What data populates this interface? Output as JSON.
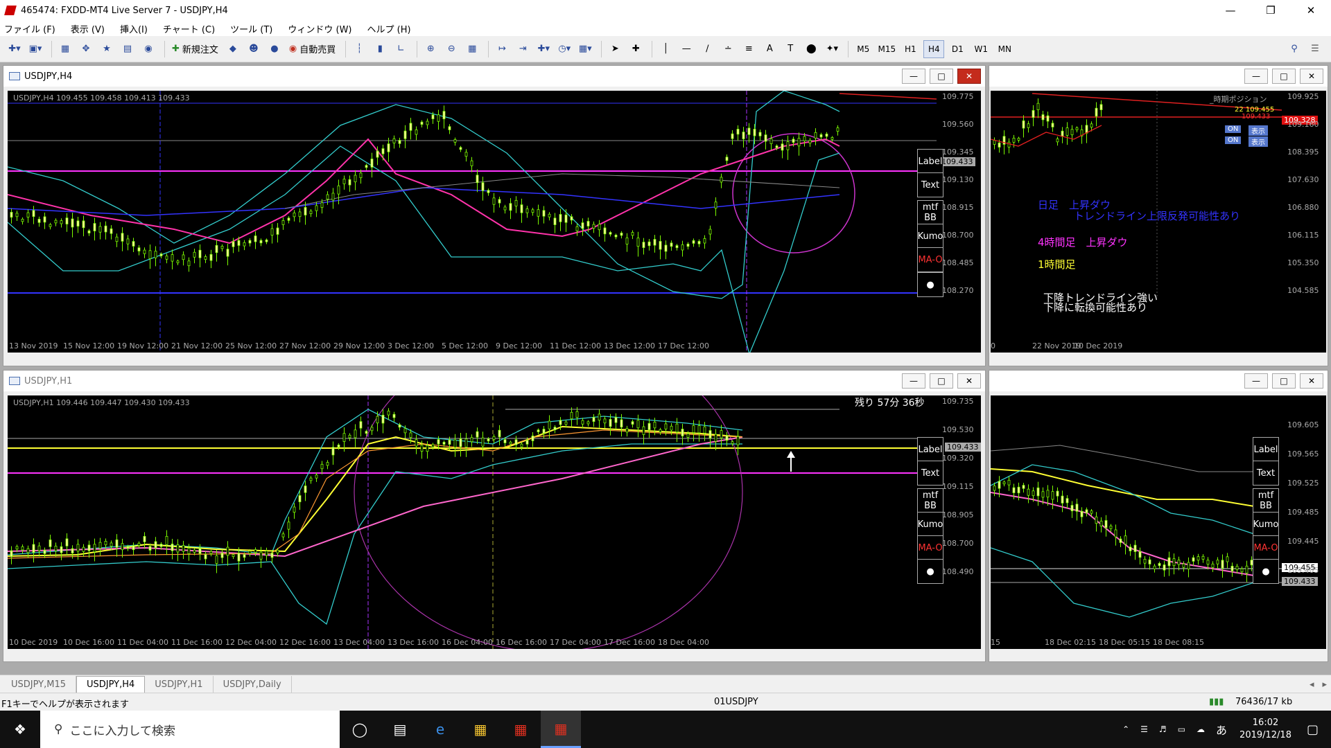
{
  "window": {
    "title": "465474: FXDD-MT4 Live Server 7 - USDJPY,H4"
  },
  "menu": [
    "ファイル (F)",
    "表示 (V)",
    "挿入(I)",
    "チャート (C)",
    "ツール (T)",
    "ウィンドウ (W)",
    "ヘルプ (H)"
  ],
  "toolbar": {
    "new_order": "新規注文",
    "auto_trade": "自動売買",
    "timeframes": [
      "M5",
      "M15",
      "H1",
      "H4",
      "D1",
      "W1",
      "MN"
    ],
    "active_timeframe": "H4"
  },
  "panel_buttons": [
    {
      "l1": "Label"
    },
    {
      "l1": "Text"
    },
    {
      "l1": "mtf",
      "l2": "BB"
    },
    {
      "l1": "Kumo"
    },
    {
      "l1": "MA-O"
    },
    {
      "l1": "●"
    }
  ],
  "charts": {
    "h4": {
      "window_title": "USDJPY,H4",
      "symbol_line": "USDJPY,H4  109.455 109.458 109.413 109.433",
      "current_price": "109.433",
      "price_labels": [
        "109.775",
        "109.560",
        "109.345",
        "109.130",
        "108.915",
        "108.700",
        "108.485",
        "108.270"
      ],
      "time_labels": [
        "13 Nov 2019",
        "15 Nov 12:00",
        "19 Nov 12:00",
        "21 Nov 12:00",
        "25 Nov 12:00",
        "27 Nov 12:00",
        "29 Nov 12:00",
        "3 Dec 12:00",
        "5 Dec 12:00",
        "9 Dec 12:00",
        "11 Dec 12:00",
        "13 Dec 12:00",
        "17 Dec 12:00"
      ]
    },
    "daily": {
      "position_label": "_時期ポジション",
      "line1": "22 109.455",
      "line2": "109.433",
      "red_price": "109.328",
      "on_labels": [
        "ON",
        "ON"
      ],
      "show_labels": [
        "表示",
        "表示"
      ],
      "price_labels": [
        "109.925",
        "109.160",
        "108.395",
        "107.630",
        "106.880",
        "106.115",
        "105.350",
        "104.585"
      ],
      "time_labels": [
        "0",
        "22 Nov 2019",
        "10 Dec 2019"
      ],
      "notes": {
        "daily": "日足　上昇ダウ",
        "daily2": "トレンドライン上限反発可能性あり",
        "h4": "4時間足　上昇ダウ",
        "h1": "1時間足",
        "down1": "下降トレンドライン強い",
        "down2": "下降に転換可能性あり"
      },
      "colors": {
        "blue": "#3333ff",
        "magenta": "#ff33ff",
        "yellow": "#ffff33",
        "white": "#ffffff"
      }
    },
    "h1": {
      "window_title": "USDJPY,H1",
      "symbol_line": "USDJPY,H1  109.446 109.447 109.430 109.433",
      "remaining": "残り  57分  36秒",
      "current_price": "109.433",
      "price_labels": [
        "109.735",
        "109.530",
        "109.320",
        "109.115",
        "108.905",
        "108.700",
        "108.490"
      ],
      "time_labels": [
        "10 Dec 2019",
        "10 Dec 16:00",
        "11 Dec 04:00",
        "11 Dec 16:00",
        "12 Dec 04:00",
        "12 Dec 16:00",
        "13 Dec 04:00",
        "13 Dec 16:00",
        "16 Dec 04:00",
        "16 Dec 16:00",
        "17 Dec 04:00",
        "17 Dec 16:00",
        "18 Dec 04:00"
      ]
    },
    "m15": {
      "price_labels": [
        "109.605",
        "109.565",
        "109.525",
        "109.485",
        "109.445",
        "109.405"
      ],
      "price_boxes": [
        "109.455",
        "109.433"
      ],
      "time_labels": [
        "15",
        "18 Dec 02:15",
        "18 Dec 05:15",
        "18 Dec 08:15"
      ]
    }
  },
  "tabs": [
    "USDJPY,M15",
    "USDJPY,H4",
    "USDJPY,H1",
    "USDJPY,Daily"
  ],
  "active_tab": "USDJPY,H4",
  "status": {
    "help": "F1キーでヘルプが表示されます",
    "profile": "01USDJPY",
    "traffic": "76436/17 kb"
  },
  "taskbar": {
    "search": "ここに入力して検索",
    "time": "16:02",
    "date": "2019/12/18",
    "ime": "あ"
  }
}
